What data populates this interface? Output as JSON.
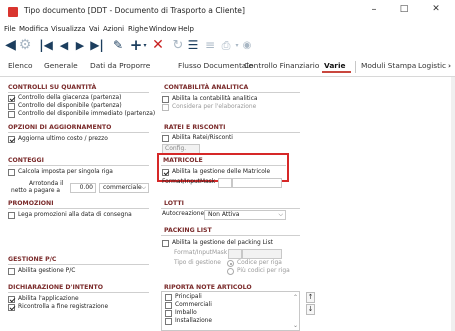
{
  "window": {
    "title": "Tipo documento [DDT - Documento di Trasporto a Cliente]",
    "minimize": "–",
    "maximize": "□",
    "close": "✕"
  },
  "menu": [
    "File",
    "Modifica",
    "Visualizza",
    "Vai",
    "Azioni",
    "Righe",
    "Window",
    "Help"
  ],
  "toolbar": {
    "icons": [
      "back-icon",
      "forward-icon",
      "first-record-icon",
      "previous-record-icon",
      "next-record-icon",
      "last-record-icon",
      "edit-icon",
      "add-icon",
      "delete-icon",
      "refresh-icon",
      "filter-icon",
      "list-icon",
      "print-icon",
      "options-dropdown-icon"
    ],
    "accent": "#1c3e5e",
    "delete_color": "#c82020"
  },
  "tabs": [
    "Elenco",
    "Generale",
    "Dati da Proporre",
    "Flusso Documentale",
    "Controllo Finanziario",
    "Varie",
    "Moduli Stampa",
    "Logistic"
  ],
  "tab_overflow": "›",
  "active_tab": "Varie",
  "left": {
    "controlli": {
      "header": "CONTROLLI SU QUANTITÀ",
      "items": [
        {
          "label": "Controllo della giacenza (partenza)",
          "checked": true
        },
        {
          "label": "Controllo del disponibile (partenza)",
          "checked": false
        },
        {
          "label": "Controllo del disponibile immediato (partenza)",
          "checked": false
        }
      ]
    },
    "aggiornamento": {
      "header": "OPZIONI DI AGGIORNAMENTO",
      "items": [
        {
          "label": "Aggiorna ultimo costo / prezzo",
          "checked": true
        }
      ]
    },
    "conteggi": {
      "header": "CONTEGGI",
      "calc_label": "Calcola imposta per singola riga",
      "calc_checked": false,
      "round_label_1": "Arrotonda il",
      "round_label_2": "netto a pagare a",
      "round_value": "0.00",
      "round_mode": "commerciale"
    },
    "promozioni": {
      "header": "PROMOZIONI",
      "items": [
        {
          "label": "Lega promozioni alla data di consegna",
          "checked": false
        }
      ]
    },
    "gestione_pc": {
      "header": "GESTIONE P/C",
      "items": [
        {
          "label": "Abilita gestione P/C",
          "checked": false
        }
      ]
    },
    "intento": {
      "header": "DICHIARAZIONE D'INTENTO",
      "items": [
        {
          "label": "Abilita l'applicazione",
          "checked": true
        },
        {
          "label": "Ricontrolla a fine registrazione",
          "checked": true
        }
      ]
    }
  },
  "right": {
    "contabilita": {
      "header": "CONTABILITÀ ANALITICA",
      "enable_label": "Abilita la contabilità analitica",
      "enable_checked": false,
      "consider_label": "Considera per l'elaborazione",
      "consider_checked": false
    },
    "ratei": {
      "header": "RATEI E RISCONTI",
      "enable_label": "Abilita Ratei/Risconti",
      "enable_checked": false,
      "config_label": "Config."
    },
    "matricole": {
      "header": "MATRICOLE",
      "enable_label": "Abilita la gestione delle Matricole",
      "enable_checked": true,
      "format_label": "Format/InputMask"
    },
    "lotti": {
      "header": "LOTTI",
      "auto_label": "Autocreazione",
      "auto_value": "Non Attiva"
    },
    "packing": {
      "header": "PACKING LIST",
      "enable_label": "Abilita la gestione del packing List",
      "enable_checked": false,
      "format_label": "Format/InputMask",
      "type_label": "Tipo di gestione",
      "options": [
        {
          "label": "Codice per riga",
          "selected": true
        },
        {
          "label": "Più codici per riga",
          "selected": false
        }
      ]
    },
    "note": {
      "header": "RIPORTA NOTE ARTICOLO",
      "items": [
        {
          "label": "Principali",
          "checked": false
        },
        {
          "label": "Commerciali",
          "checked": false
        },
        {
          "label": "Imballo",
          "checked": false
        },
        {
          "label": "Installazione",
          "checked": false
        }
      ],
      "up_label": "↑",
      "down_label": "↓"
    }
  },
  "highlight_color": "#d62828"
}
